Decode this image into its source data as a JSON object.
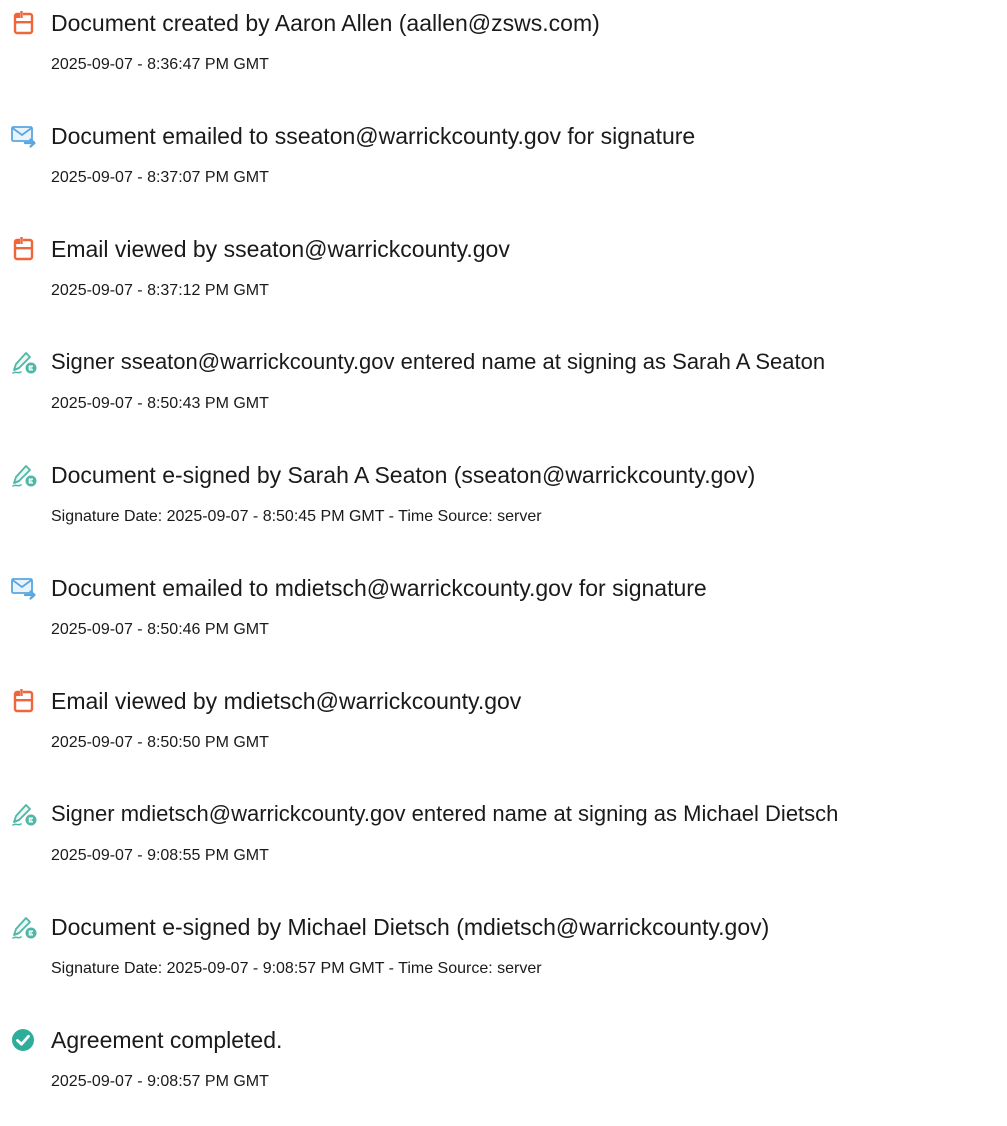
{
  "colors": {
    "document_icon": "#F0653A",
    "email_icon": "#5AA6E0",
    "esign_icon": "#4FB7A6",
    "complete_icon": "#2EAE9A",
    "text": "#1a1a1a"
  },
  "events": [
    {
      "icon": "document-icon",
      "title": "Document created by Aaron Allen (aallen@zsws.com)",
      "subtitle": "2025-09-07 - 8:36:47 PM GMT"
    },
    {
      "icon": "email-send-icon",
      "title": "Document emailed to sseaton@warrickcounty.gov for signature",
      "subtitle": "2025-09-07 - 8:37:07 PM GMT"
    },
    {
      "icon": "document-icon",
      "title": "Email viewed by sseaton@warrickcounty.gov",
      "subtitle": "2025-09-07 - 8:37:12 PM GMT"
    },
    {
      "icon": "esign-pen-icon",
      "title": "Signer sseaton@warrickcounty.gov entered name at signing as Sarah A Seaton",
      "subtitle": "2025-09-07 - 8:50:43 PM GMT"
    },
    {
      "icon": "esign-pen-icon",
      "title": "Document e-signed by Sarah A Seaton (sseaton@warrickcounty.gov)",
      "subtitle": "Signature Date: 2025-09-07 - 8:50:45 PM GMT - Time Source: server"
    },
    {
      "icon": "email-send-icon",
      "title": "Document emailed to mdietsch@warrickcounty.gov for signature",
      "subtitle": "2025-09-07 - 8:50:46 PM GMT"
    },
    {
      "icon": "document-icon",
      "title": "Email viewed by mdietsch@warrickcounty.gov",
      "subtitle": "2025-09-07 - 8:50:50 PM GMT"
    },
    {
      "icon": "esign-pen-icon",
      "title": "Signer mdietsch@warrickcounty.gov entered name at signing as Michael Dietsch",
      "subtitle": "2025-09-07 - 9:08:55 PM GMT"
    },
    {
      "icon": "esign-pen-icon",
      "title": "Document e-signed by Michael Dietsch (mdietsch@warrickcounty.gov)",
      "subtitle": "Signature Date: 2025-09-07 - 9:08:57 PM GMT - Time Source: server"
    },
    {
      "icon": "check-circle-icon",
      "title": "Agreement completed.",
      "subtitle": "2025-09-07 - 9:08:57 PM GMT"
    }
  ]
}
